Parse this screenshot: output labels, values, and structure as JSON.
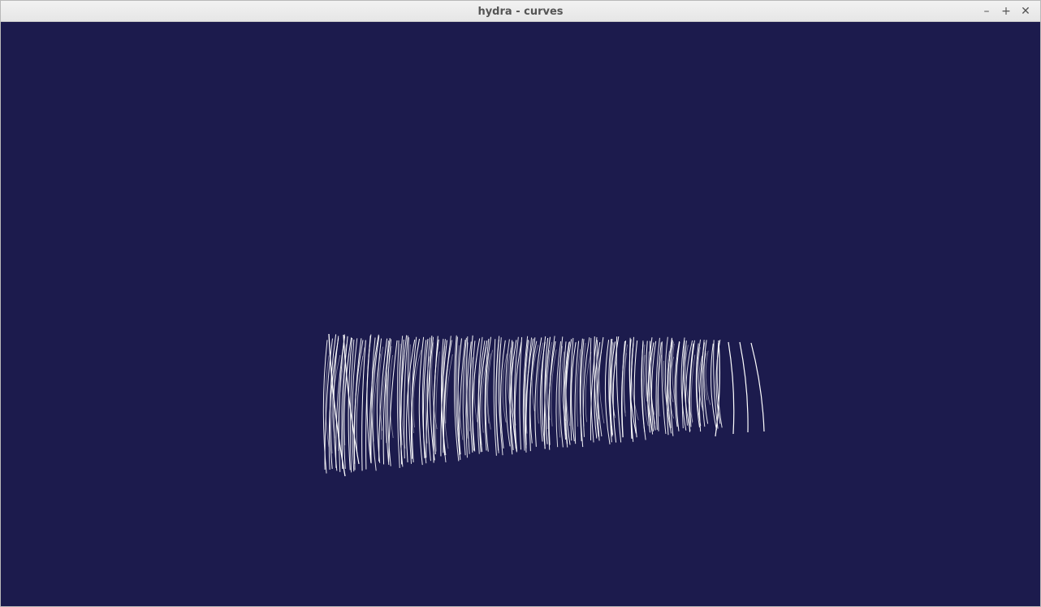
{
  "window": {
    "title": "hydra - curves",
    "controls": {
      "minimize": "–",
      "maximize": "+",
      "close": "✕"
    }
  },
  "viewport": {
    "background_color": "#1c1b4d",
    "curve_color": "#ffffff"
  }
}
